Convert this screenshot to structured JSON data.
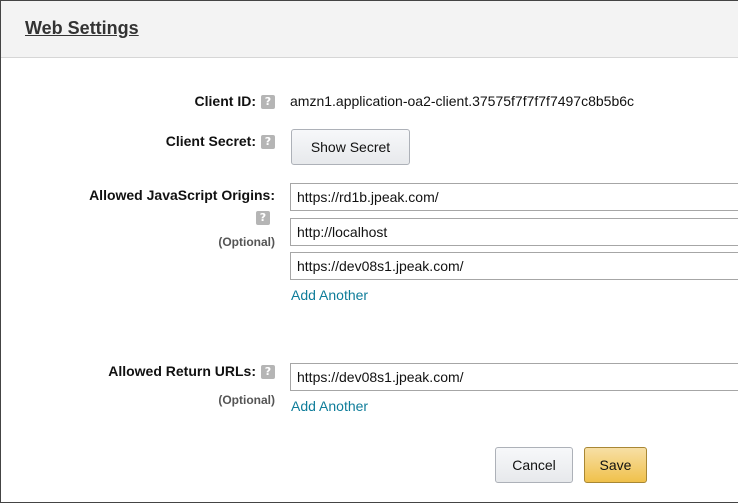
{
  "header": {
    "title": "Web Settings"
  },
  "client_id": {
    "label": "Client ID:",
    "value": "amzn1.application-oa2-client.37575f7f7f7f7497c8b5b6c"
  },
  "client_secret": {
    "label": "Client Secret:",
    "button_label": "Show Secret"
  },
  "allowed_js_origins": {
    "label": "Allowed JavaScript Origins:",
    "optional_label": "(Optional)",
    "values": [
      "https://rd1b.jpeak.com/",
      "http://localhost",
      "https://dev08s1.jpeak.com/"
    ],
    "add_another_label": "Add Another"
  },
  "allowed_return_urls": {
    "label": "Allowed Return URLs:",
    "optional_label": "(Optional)",
    "values": [
      "https://dev08s1.jpeak.com/"
    ],
    "add_another_label": "Add Another"
  },
  "actions": {
    "cancel_label": "Cancel",
    "save_label": "Save"
  },
  "help_icon_glyph": "?"
}
